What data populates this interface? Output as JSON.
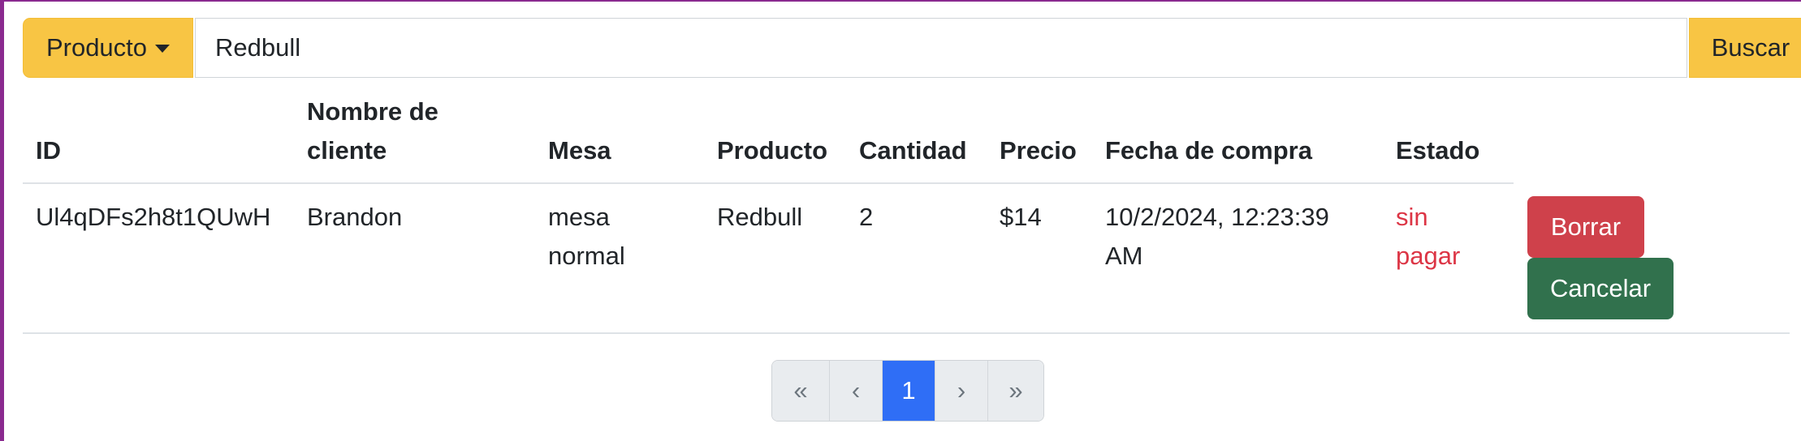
{
  "search": {
    "dropdown_label": "Producto",
    "input_value": "Redbull",
    "button_label": "Buscar"
  },
  "table": {
    "headers": {
      "id": "ID",
      "cliente_line1": "Nombre de",
      "cliente_line2": "cliente",
      "mesa": "Mesa",
      "producto": "Producto",
      "cantidad": "Cantidad",
      "precio": "Precio",
      "fecha": "Fecha de compra",
      "estado": "Estado"
    },
    "rows": [
      {
        "id": "Ul4qDFs2h8t1QUwH",
        "cliente": "Brandon",
        "mesa_line1": "mesa",
        "mesa_line2": "normal",
        "producto": "Redbull",
        "cantidad": "2",
        "precio": "$14",
        "fecha_line1": "10/2/2024, 12:23:39",
        "fecha_line2": "AM",
        "estado_line1": "sin",
        "estado_line2": "pagar",
        "borrar_label": "Borrar",
        "cancelar_label": "Cancelar"
      }
    ]
  },
  "pagination": {
    "first": "«",
    "prev": "‹",
    "current": "1",
    "next": "›",
    "last": "»"
  },
  "colors": {
    "warning": "#f8c544",
    "danger": "#cf414b",
    "success": "#31714d",
    "primary": "#2f6ef6",
    "frame_accent": "#8a2a8f"
  }
}
